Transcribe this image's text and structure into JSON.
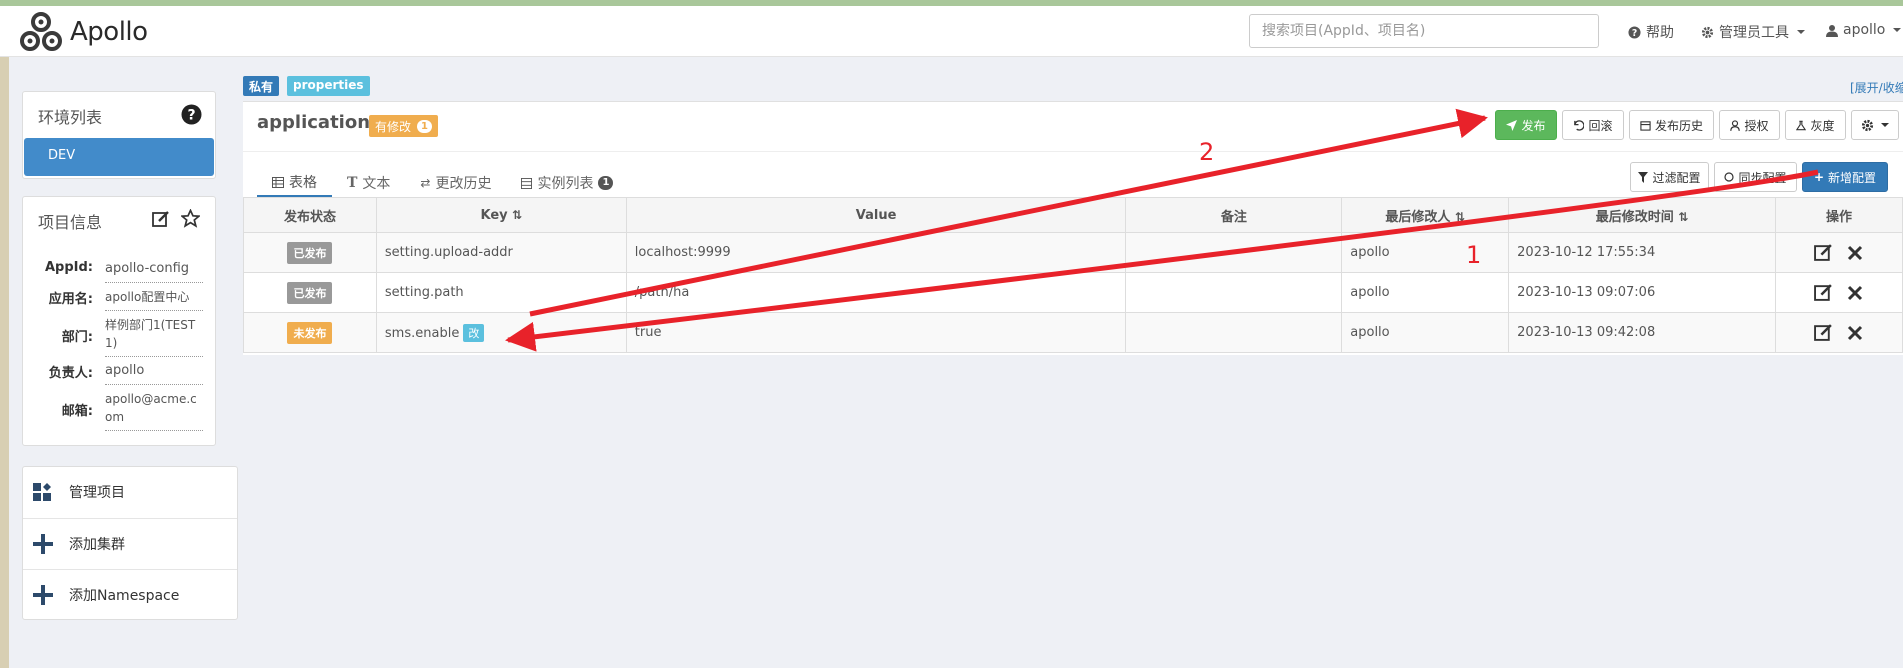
{
  "app": {
    "name": "Apollo"
  },
  "nav": {
    "search_placeholder": "搜索项目(AppId、项目名)",
    "help": "帮助",
    "admin_tools": "管理员工具",
    "user": "apollo"
  },
  "sidebar": {
    "env_title": "环境列表",
    "env_items": [
      "DEV"
    ],
    "info_title": "项目信息",
    "info": [
      {
        "label": "AppId:",
        "value": "apollo-config"
      },
      {
        "label": "应用名:",
        "value": "apollo配置中心"
      },
      {
        "label": "部门:",
        "value": "样例部门1(TEST1)"
      },
      {
        "label": "负责人:",
        "value": "apollo"
      },
      {
        "label": "邮箱:",
        "value": "apollo@acme.com"
      }
    ],
    "menu": [
      "管理项目",
      "添加集群",
      "添加Namespace"
    ]
  },
  "namespace": {
    "label_private": "私有",
    "label_format": "properties",
    "expand_link": "[展开/收缩]",
    "title": "application",
    "modified_badge": "有修改",
    "modified_count": "1",
    "buttons": {
      "publish": "发布",
      "rollback": "回滚",
      "history": "发布历史",
      "auth": "授权",
      "gray": "灰度"
    },
    "tabs": [
      {
        "label": "表格"
      },
      {
        "label": "文本"
      },
      {
        "label": "更改历史"
      },
      {
        "label": "实例列表",
        "count": "1"
      }
    ],
    "filter_btn": "过滤配置",
    "sync_btn": "同步配置",
    "add_btn": "新增配置",
    "columns": [
      "发布状态",
      "Key",
      "Value",
      "备注",
      "最后修改人",
      "最后修改时间",
      "操作"
    ],
    "rows": [
      {
        "status": "已发布",
        "key": "setting.upload-addr",
        "value": "localhost:9999",
        "comment": "",
        "modifier": "apollo",
        "time": "2023-10-12 17:55:34"
      },
      {
        "status": "已发布",
        "key": "setting.path",
        "value": "/path/ha",
        "comment": "",
        "modifier": "apollo",
        "time": "2023-10-13 09:07:06"
      },
      {
        "status": "未发布",
        "key": "sms.enable",
        "key_badge": "改",
        "value": "true",
        "comment": "",
        "modifier": "apollo",
        "time": "2023-10-13 09:42:08"
      }
    ]
  },
  "annotations": {
    "step1": "1",
    "step2": "2"
  },
  "colors": {
    "primary": "#337ab7",
    "success": "#5cb85c",
    "warning": "#f0ad4e",
    "info": "#5bc0de",
    "arrow": "#e8222a"
  }
}
